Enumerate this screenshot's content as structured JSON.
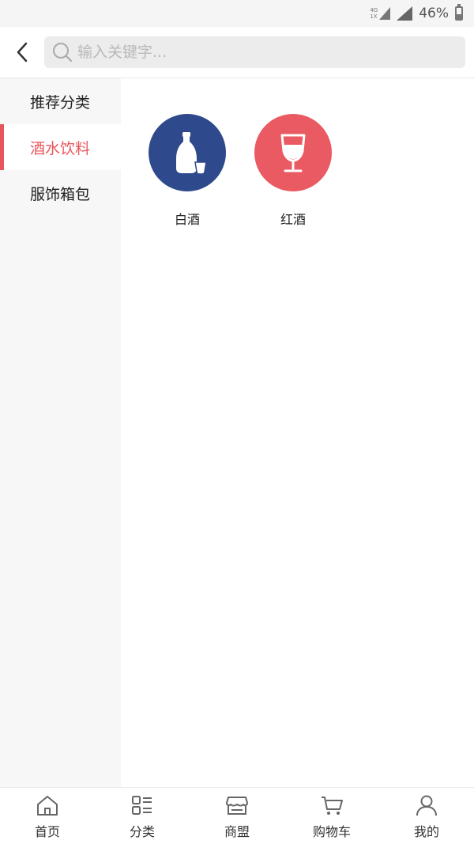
{
  "status_bar": {
    "network_top": "4G",
    "network_bottom": "1X",
    "battery_text": "46%",
    "battery_level": 0.46
  },
  "header": {
    "search_placeholder": "输入关键字..."
  },
  "sidebar": {
    "items": [
      {
        "label": "推荐分类",
        "active": false
      },
      {
        "label": "酒水饮料",
        "active": true
      },
      {
        "label": "服饰箱包",
        "active": false
      }
    ]
  },
  "content": {
    "categories": [
      {
        "label": "白酒",
        "icon": "baijiu-bottle-icon",
        "color": "#2e4a8c"
      },
      {
        "label": "红酒",
        "icon": "wine-glass-icon",
        "color": "#ea5a62"
      }
    ]
  },
  "bottom_nav": {
    "items": [
      {
        "label": "首页",
        "icon": "home-icon"
      },
      {
        "label": "分类",
        "icon": "category-icon"
      },
      {
        "label": "商盟",
        "icon": "store-icon"
      },
      {
        "label": "购物车",
        "icon": "cart-icon"
      },
      {
        "label": "我的",
        "icon": "user-icon"
      }
    ]
  },
  "colors": {
    "accent": "#e8555c",
    "sidebar_bg": "#f7f7f7"
  }
}
